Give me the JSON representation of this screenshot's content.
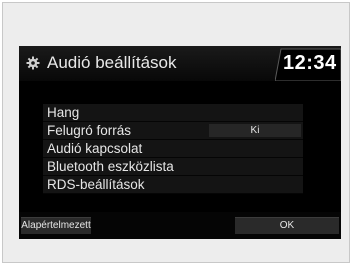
{
  "header": {
    "title": "Audió beállítások",
    "clock": "12:34",
    "icon": "gear-icon"
  },
  "menu": {
    "items": [
      {
        "label": "Hang",
        "value": ""
      },
      {
        "label": "Felugró forrás",
        "value": "Ki"
      },
      {
        "label": "Audió kapcsolat",
        "value": ""
      },
      {
        "label": "Bluetooth eszközlista",
        "value": ""
      },
      {
        "label": "RDS-beállítások",
        "value": ""
      }
    ]
  },
  "footer": {
    "reset_label": "Alapértelmezett",
    "ok_label": "OK"
  },
  "colors": {
    "screen_bg": "#000000",
    "text": "#e6e6e6",
    "frame_bg": "#ededed"
  }
}
